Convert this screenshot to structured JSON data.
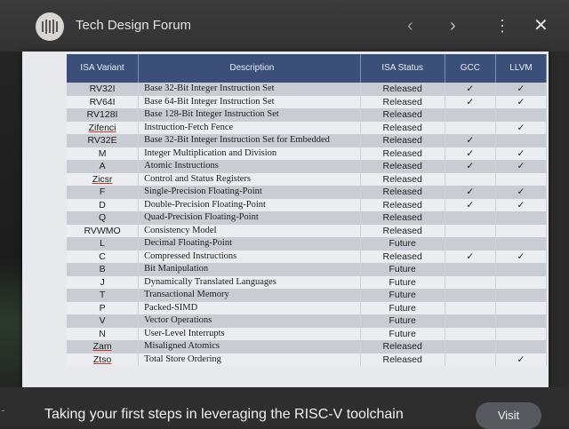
{
  "app": {
    "title": "Tech Design Forum",
    "logo_icon": "book-spines-icon",
    "prev_icon": "‹",
    "next_icon": "›",
    "more_icon": "⋮",
    "close_icon": "✕"
  },
  "table": {
    "headers": {
      "variant": "ISA Variant",
      "description": "Description",
      "status": "ISA Status",
      "gcc": "GCC",
      "llvm": "LLVM"
    },
    "rows": [
      {
        "variant": "RV32I",
        "description": "Base 32-Bit Integer Instruction Set",
        "status": "Released",
        "gcc": "✓",
        "llvm": "✓"
      },
      {
        "variant": "RV64I",
        "description": "Base 64-Bit Integer Instruction Set",
        "status": "Released",
        "gcc": "✓",
        "llvm": "✓"
      },
      {
        "variant": "RV128I",
        "description": "Base 128-Bit Integer Instruction Set",
        "status": "Released",
        "gcc": "",
        "llvm": ""
      },
      {
        "variant": "Zifenci",
        "description": "Instruction-Fetch Fence",
        "status": "Released",
        "gcc": "",
        "llvm": "✓"
      },
      {
        "variant": "RV32E",
        "description": "Base 32-Bit Integer Instruction Set for Embedded",
        "status": "Released",
        "gcc": "✓",
        "llvm": ""
      },
      {
        "variant": "M",
        "description": "Integer Multiplication and Division",
        "status": "Released",
        "gcc": "✓",
        "llvm": "✓"
      },
      {
        "variant": "A",
        "description": "Atomic Instructions",
        "status": "Released",
        "gcc": "✓",
        "llvm": "✓"
      },
      {
        "variant": "Zicsr",
        "description": "Control and Status Registers",
        "status": "Released",
        "gcc": "",
        "llvm": ""
      },
      {
        "variant": "F",
        "description": "Single-Precision Floating-Point",
        "status": "Released",
        "gcc": "✓",
        "llvm": "✓"
      },
      {
        "variant": "D",
        "description": "Double-Precision Floating-Point",
        "status": "Released",
        "gcc": "✓",
        "llvm": "✓"
      },
      {
        "variant": "Q",
        "description": "Quad-Precision Floating-Point",
        "status": "Released",
        "gcc": "",
        "llvm": ""
      },
      {
        "variant": "RVWMO",
        "description": "Consistency Model",
        "status": "Released",
        "gcc": "",
        "llvm": ""
      },
      {
        "variant": "L",
        "description": "Decimal Floating-Point",
        "status": "Future",
        "gcc": "",
        "llvm": ""
      },
      {
        "variant": "C",
        "description": "Compressed Instructions",
        "status": "Released",
        "gcc": "✓",
        "llvm": "✓"
      },
      {
        "variant": "B",
        "description": "Bit Manipulation",
        "status": "Future",
        "gcc": "",
        "llvm": ""
      },
      {
        "variant": "J",
        "description": "Dynamically Translated Languages",
        "status": "Future",
        "gcc": "",
        "llvm": ""
      },
      {
        "variant": "T",
        "description": "Transactional Memory",
        "status": "Future",
        "gcc": "",
        "llvm": ""
      },
      {
        "variant": "P",
        "description": "Packed-SIMD",
        "status": "Future",
        "gcc": "",
        "llvm": ""
      },
      {
        "variant": "V",
        "description": "Vector Operations",
        "status": "Future",
        "gcc": "",
        "llvm": ""
      },
      {
        "variant": "N",
        "description": "User-Level Interrupts",
        "status": "Future",
        "gcc": "",
        "llvm": ""
      },
      {
        "variant": "Zam",
        "description": "Misaligned Atomics",
        "status": "Released",
        "gcc": "",
        "llvm": ""
      },
      {
        "variant": "Ztso",
        "description": "Total Store Ordering",
        "status": "Released",
        "gcc": "",
        "llvm": "✓"
      }
    ]
  },
  "lens": {
    "icon": "lens-search-icon"
  },
  "footer": {
    "caption": "Taking your first steps in leveraging the RISC-V toolchain",
    "visit_label": "Visit"
  },
  "colors": {
    "header_bg": "#3b4f78",
    "row_odd": "#c9ccd3",
    "row_even": "#ebedf0",
    "top_bar": "#3a3a3a"
  }
}
